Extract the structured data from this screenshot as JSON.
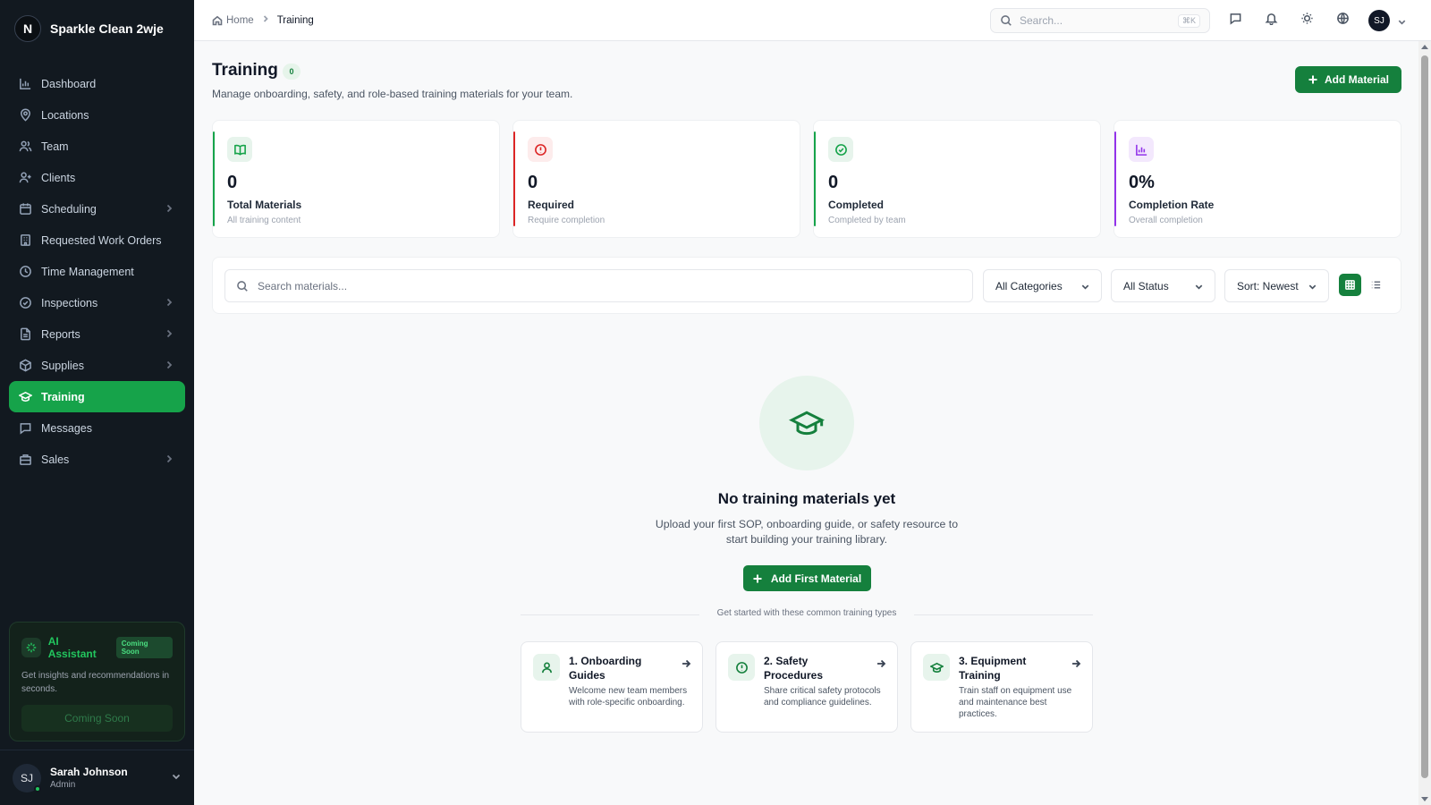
{
  "brand": {
    "logo_letter": "N",
    "name": "Sparkle Clean 2wje"
  },
  "sidebar": {
    "items": [
      {
        "label": "Dashboard",
        "icon": "bar-chart-icon",
        "has_children": false,
        "active": false
      },
      {
        "label": "Locations",
        "icon": "map-pin-icon",
        "has_children": false,
        "active": false
      },
      {
        "label": "Team",
        "icon": "users-icon",
        "has_children": false,
        "active": false
      },
      {
        "label": "Clients",
        "icon": "user-plus-icon",
        "has_children": false,
        "active": false
      },
      {
        "label": "Scheduling",
        "icon": "calendar-icon",
        "has_children": true,
        "active": false
      },
      {
        "label": "Requested Work Orders",
        "icon": "building-icon",
        "has_children": false,
        "active": false
      },
      {
        "label": "Time Management",
        "icon": "clock-icon",
        "has_children": false,
        "active": false
      },
      {
        "label": "Inspections",
        "icon": "check-circle-icon",
        "has_children": true,
        "active": false
      },
      {
        "label": "Reports",
        "icon": "file-text-icon",
        "has_children": true,
        "active": false
      },
      {
        "label": "Supplies",
        "icon": "package-icon",
        "has_children": true,
        "active": false
      },
      {
        "label": "Training",
        "icon": "graduation-cap-icon",
        "has_children": false,
        "active": true
      },
      {
        "label": "Messages",
        "icon": "message-square-icon",
        "has_children": false,
        "active": false
      },
      {
        "label": "Sales",
        "icon": "briefcase-icon",
        "has_children": true,
        "active": false
      }
    ],
    "ai_assistant": {
      "title": "AI Assistant",
      "badge": "Coming Soon",
      "description": "Get insights and recommendations in seconds.",
      "button_label": "Coming Soon"
    },
    "user": {
      "initials": "SJ",
      "name": "Sarah Johnson",
      "role": "Admin"
    }
  },
  "topbar": {
    "breadcrumb": {
      "home": "Home",
      "current": "Training"
    },
    "search": {
      "placeholder": "Search...",
      "shortcut": "⌘K"
    },
    "avatar_initials": "SJ"
  },
  "page": {
    "title": "Training",
    "count": "0",
    "subtitle": "Manage onboarding, safety, and role-based training materials for your team.",
    "add_button_label": "Add Material"
  },
  "stats": [
    {
      "value": "0",
      "label": "Total Materials",
      "description": "All training content",
      "accent": "#16a34a",
      "icon": "book-open-icon"
    },
    {
      "value": "0",
      "label": "Required",
      "description": "Require completion",
      "accent": "#dc2626",
      "icon": "alert-circle-icon"
    },
    {
      "value": "0",
      "label": "Completed",
      "description": "Completed by team",
      "accent": "#16a34a",
      "icon": "check-circle-icon"
    },
    {
      "value": "0%",
      "label": "Completion Rate",
      "description": "Overall completion",
      "accent": "#9333ea",
      "icon": "bar-chart-icon"
    }
  ],
  "filters": {
    "search_placeholder": "Search materials...",
    "category": "All Categories",
    "status": "All Status",
    "sort": "Sort: Newest",
    "view_mode": "grid"
  },
  "empty_state": {
    "title": "No training materials yet",
    "description": "Upload your first SOP, onboarding guide, or safety resource to start building your training library.",
    "button_label": "Add First Material",
    "divider_text": "Get started with these common training types",
    "types": [
      {
        "title": "1. Onboarding Guides",
        "description": "Welcome new team members with role-specific onboarding.",
        "icon": "user-icon"
      },
      {
        "title": "2. Safety Procedures",
        "description": "Share critical safety protocols and compliance guidelines.",
        "icon": "alert-circle-icon"
      },
      {
        "title": "3. Equipment Training",
        "description": "Train staff on equipment use and maintenance best practices.",
        "icon": "graduation-cap-icon"
      }
    ]
  }
}
